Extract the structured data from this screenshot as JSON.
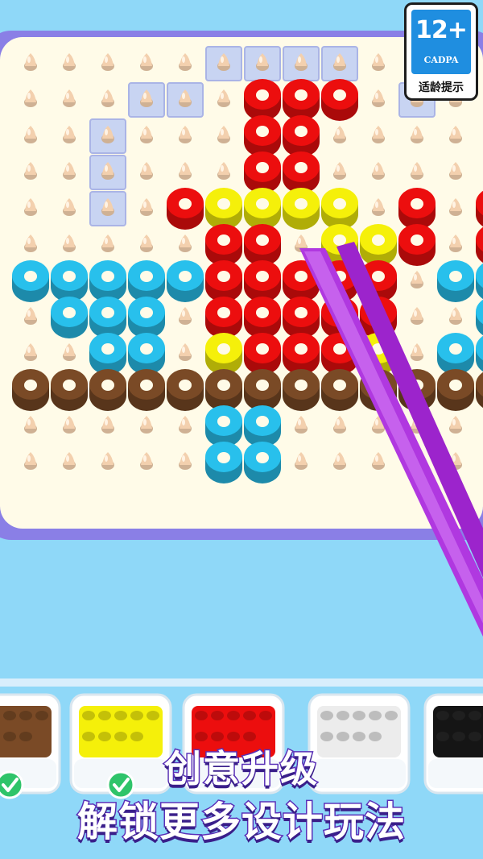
{
  "age_rating": {
    "age": "12+",
    "org": "CADPA",
    "note": "适龄提示"
  },
  "banner": {
    "line1": "创意升级",
    "line2": "解锁更多设计玩法"
  },
  "colors": {
    "red": "#ec0e0e",
    "yellow": "#f5f00a",
    "blue": "#28c0ec",
    "brown": "#7a4a26",
    "board": "#fffbe8",
    "board_frame": "#8a7fe6",
    "highlight": "#c8d4f2",
    "peg": "#f3d0ae",
    "tweezers": "#b038e0",
    "background": "#8fd8f8"
  },
  "board": {
    "rows": [
      ".....HHHH......",
      "...HH.RRR.H....",
      "..H...RR.....R.",
      "..H...RR.....R.",
      "..H.RYYYY.R.R..",
      ".....RR.YYR.R..",
      "BBBBBRRRRR.BBBB",
      ".BBB.RRRRR..BBB",
      "..BB.YRRRY.BB..",
      "NNNNNNNNNNNNNNN",
      ".....BB........",
      ".....BB........"
    ]
  },
  "trays": [
    {
      "name": "brown",
      "checked": true
    },
    {
      "name": "yellow",
      "checked": true
    },
    {
      "name": "red",
      "checked": false
    },
    {
      "name": "white",
      "checked": false
    },
    {
      "name": "black",
      "checked": false
    }
  ]
}
